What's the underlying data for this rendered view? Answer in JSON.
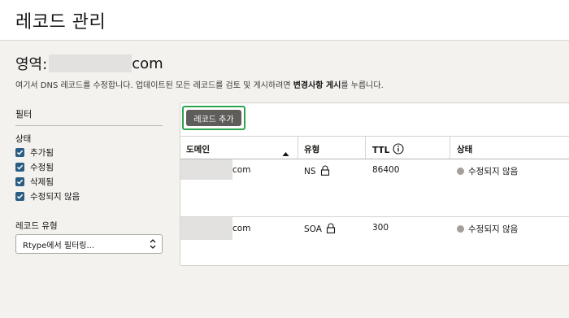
{
  "header": {
    "title": "레코드 관리"
  },
  "zone": {
    "label": "영역:",
    "domain_suffix": "com",
    "desc_prefix": "여기서 DNS 레코드를 수정합니다. 업데이트된 모든 레코드를 검토 및 게시하려면 ",
    "desc_bold": "변경사항 게시",
    "desc_suffix": "를 누릅니다."
  },
  "filters": {
    "title": "필터",
    "state_label": "상태",
    "states": [
      "추가됨",
      "수정됨",
      "삭제됨",
      "수정되지 않음"
    ],
    "rtype_label": "레코드 유형",
    "rtype_placeholder": "Rtype에서 필터링..."
  },
  "toolbar": {
    "add_label": "레코드 추가"
  },
  "table": {
    "headers": {
      "domain": "도메인",
      "type": "유형",
      "ttl": "TTL",
      "state": "상태"
    },
    "rows": [
      {
        "domain_suffix": "com",
        "type": "NS",
        "ttl": "86400",
        "state": "수정되지 않음"
      },
      {
        "domain_suffix": "com",
        "type": "SOA",
        "ttl": "300",
        "state": "수정되지 않음"
      }
    ]
  },
  "colors": {
    "accent": "#2a5d83",
    "highlight": "#2ea44f",
    "button": "#5f5d5a"
  },
  "icons": [
    "check-icon",
    "chevron-updown-icon",
    "sort-up-icon",
    "info-icon",
    "lock-icon",
    "status-dot-icon"
  ]
}
